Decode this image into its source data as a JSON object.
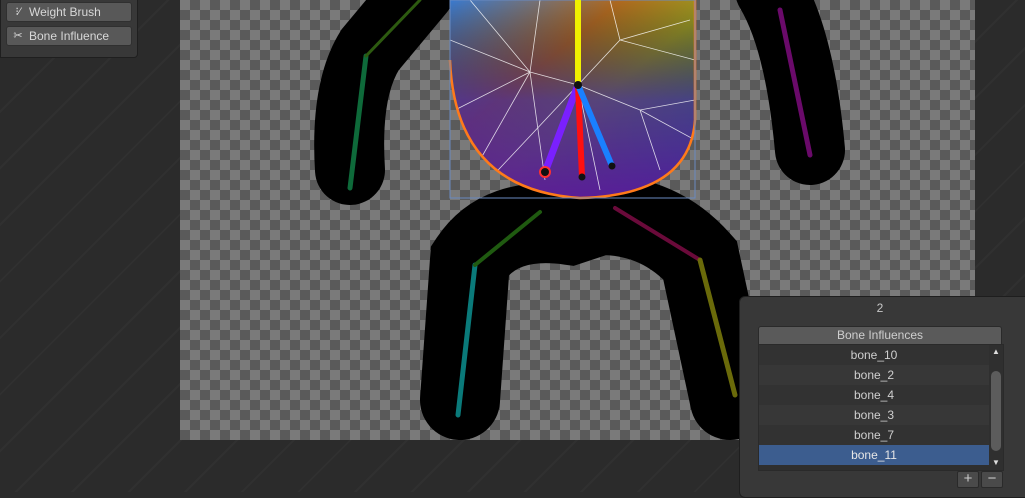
{
  "tools": {
    "weight_brush": {
      "label": "Weight Brush",
      "icon": "weight-brush-icon"
    },
    "bone_influence": {
      "label": "Bone Influence",
      "icon": "bone-influence-icon"
    }
  },
  "influence_panel": {
    "count": "2",
    "header": "Bone Influences",
    "items": [
      {
        "label": "bone_10",
        "selected": false
      },
      {
        "label": "bone_2",
        "selected": false
      },
      {
        "label": "bone_4",
        "selected": false
      },
      {
        "label": "bone_3",
        "selected": false
      },
      {
        "label": "bone_7",
        "selected": false
      },
      {
        "label": "bone_11",
        "selected": true
      }
    ],
    "add_label": "+",
    "remove_label": "−"
  },
  "colors": {
    "selection": "#3c5d8f",
    "outline": "#ff7a1a"
  }
}
